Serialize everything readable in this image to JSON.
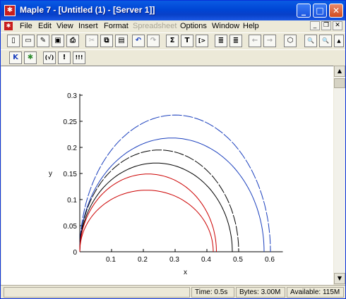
{
  "window": {
    "title": "Maple 7  - [Untitled (1) - [Server 1]]",
    "app_icon": "maple-leaf-icon",
    "controls": {
      "minimize": "_",
      "maximize": "□",
      "close": "✕"
    }
  },
  "menubar": {
    "items": [
      {
        "label": "File",
        "enabled": true
      },
      {
        "label": "Edit",
        "enabled": true
      },
      {
        "label": "View",
        "enabled": true
      },
      {
        "label": "Insert",
        "enabled": true
      },
      {
        "label": "Format",
        "enabled": true
      },
      {
        "label": "Spreadsheet",
        "enabled": false
      },
      {
        "label": "Options",
        "enabled": true
      },
      {
        "label": "Window",
        "enabled": true
      },
      {
        "label": "Help",
        "enabled": true
      }
    ],
    "mdi": {
      "minimize": "_",
      "restore": "❐",
      "close": "✕"
    }
  },
  "toolbar1": {
    "buttons": [
      {
        "name": "new-document",
        "glyph": "▯"
      },
      {
        "name": "open",
        "glyph": "▭"
      },
      {
        "name": "open-url",
        "glyph": "✎"
      },
      {
        "name": "save",
        "glyph": "▣"
      },
      {
        "name": "print",
        "glyph": "⎙"
      },
      {
        "name": "cut",
        "glyph": "✂"
      },
      {
        "name": "copy",
        "glyph": "⧉"
      },
      {
        "name": "paste",
        "glyph": "▤"
      },
      {
        "name": "undo",
        "glyph": "↶"
      },
      {
        "name": "redo",
        "glyph": "↷"
      },
      {
        "name": "sigma",
        "glyph": "Σ"
      },
      {
        "name": "text",
        "glyph": "T"
      },
      {
        "name": "maple-input",
        "glyph": "[>"
      },
      {
        "name": "indent-left",
        "glyph": "≣"
      },
      {
        "name": "indent-right",
        "glyph": "≣"
      },
      {
        "name": "back",
        "glyph": "←"
      },
      {
        "name": "forward",
        "glyph": "→"
      },
      {
        "name": "stop",
        "glyph": "⬡"
      },
      {
        "name": "zoom-in",
        "glyph": "🔍"
      },
      {
        "name": "zoom-out",
        "glyph": "🔍"
      }
    ]
  },
  "toolbar2": {
    "buttons": [
      {
        "name": "restart",
        "glyph": "K"
      },
      {
        "name": "debug",
        "glyph": "✱"
      },
      {
        "name": "sqrt",
        "glyph": "(√)"
      },
      {
        "name": "execute",
        "glyph": "!"
      },
      {
        "name": "execute-all",
        "glyph": "!!!"
      }
    ]
  },
  "status": {
    "time_label": "Time:",
    "time_value": "0.5s",
    "bytes_label": "Bytes:",
    "bytes_value": "3.00M",
    "available_label": "Available:",
    "available_value": "115M"
  },
  "colors": {
    "titlebar": "#0a5be3",
    "blue_curve": "#1a3fbd",
    "black_curve": "#000000",
    "red_curve": "#cc0000"
  },
  "chart_data": {
    "type": "line",
    "title": "",
    "xlabel": "x",
    "ylabel": "y",
    "xlim": [
      0,
      0.63
    ],
    "ylim": [
      0,
      0.3
    ],
    "x_ticks": [
      "0.1",
      "0.2",
      "0.3",
      "0.4",
      "0.5",
      "0.6"
    ],
    "y_ticks": [
      "0",
      "0.05",
      "0.1",
      "0.15",
      "0.2",
      "0.25",
      "0.3"
    ],
    "grid": false,
    "legend": "none",
    "series": [
      {
        "color": "blue",
        "dashed": true,
        "x_max": 0.6,
        "y_peak": 0.262,
        "x_peak": 0.3
      },
      {
        "color": "blue",
        "dashed": false,
        "x_max": 0.58,
        "y_peak": 0.218,
        "x_peak": 0.29
      },
      {
        "color": "black",
        "dashed": true,
        "x_max": 0.5,
        "y_peak": 0.195,
        "x_peak": 0.25
      },
      {
        "color": "black",
        "dashed": false,
        "x_max": 0.48,
        "y_peak": 0.17,
        "x_peak": 0.24
      },
      {
        "color": "red",
        "dashed": false,
        "x_max": 0.43,
        "y_peak": 0.149,
        "x_peak": 0.215
      },
      {
        "color": "red",
        "dashed": false,
        "x_max": 0.42,
        "y_peak": 0.118,
        "x_peak": 0.21
      }
    ]
  }
}
